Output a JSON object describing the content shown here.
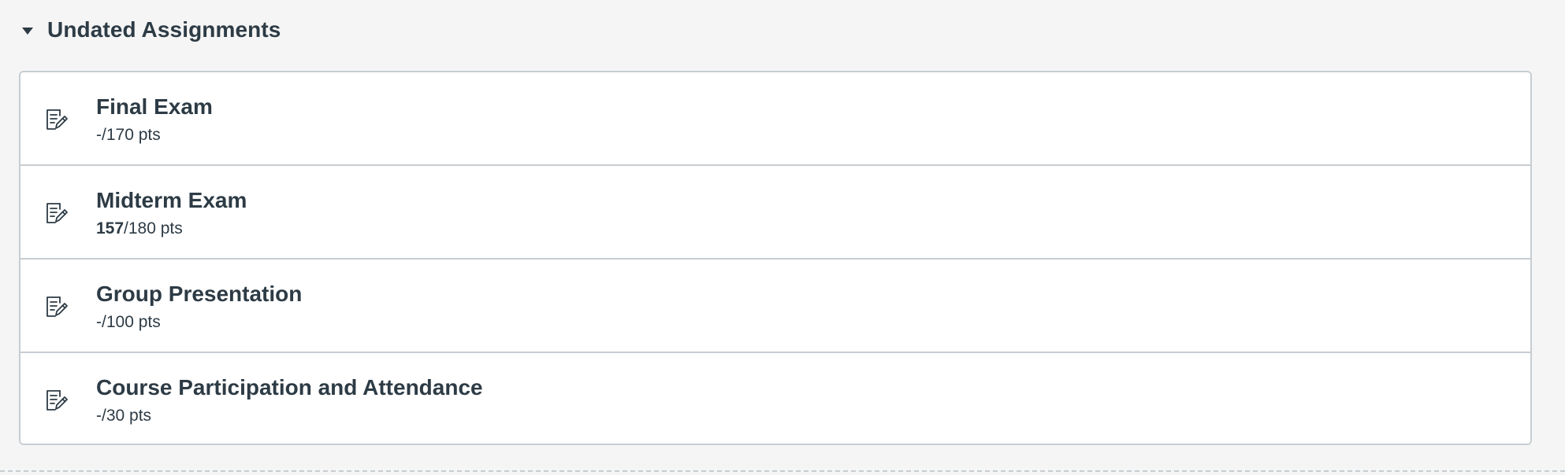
{
  "group": {
    "title": "Undated Assignments"
  },
  "assignments": [
    {
      "title": "Final Exam",
      "score_got": "-",
      "score_rest": "/170 pts"
    },
    {
      "title": "Midterm Exam",
      "score_got": "157",
      "score_rest": "/180 pts"
    },
    {
      "title": "Group Presentation",
      "score_got": "-",
      "score_rest": "/100 pts"
    },
    {
      "title": "Course Participation and Attendance",
      "score_got": "-",
      "score_rest": "/30 pts"
    }
  ],
  "icons": {
    "group_toggle": "caret-down-icon",
    "assignment": "assignment-icon"
  },
  "colors": {
    "text": "#2d3b45",
    "border": "#c7cdd1",
    "background": "#f5f5f5",
    "card": "#ffffff"
  }
}
